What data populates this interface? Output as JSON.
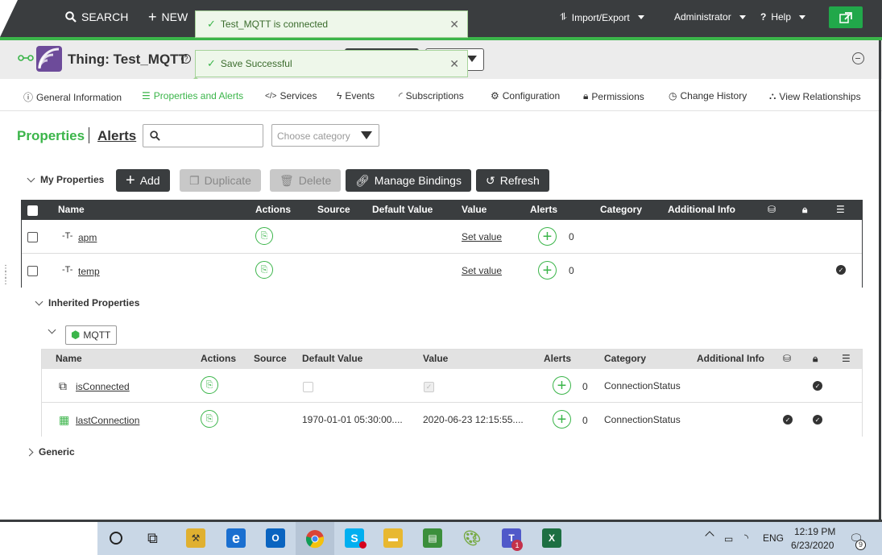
{
  "topbar": {
    "search_label": "SEARCH",
    "new_label": "NEW",
    "import_export_label": "Import/Export",
    "user_label": "Administrator",
    "help_label": "Help"
  },
  "toasts": {
    "connected": "Test_MQTT is connected",
    "saved": "Save Successful"
  },
  "header": {
    "thing_title": "Thing: Test_MQTT"
  },
  "tabs": [
    {
      "label": "General Information"
    },
    {
      "label": "Properties and Alerts"
    },
    {
      "label": "Services"
    },
    {
      "label": "Events"
    },
    {
      "label": "Subscriptions"
    },
    {
      "label": "Configuration"
    },
    {
      "label": "Permissions"
    },
    {
      "label": "Change History"
    },
    {
      "label": "View Relationships"
    }
  ],
  "properties_panel": {
    "properties_link": "Properties",
    "alerts_link": "Alerts",
    "category_placeholder": "Choose category",
    "my_properties_label": "My Properties",
    "inherited_label": "Inherited Properties",
    "mqtt_label": "MQTT",
    "generic_label": "Generic"
  },
  "toolbar": {
    "add": "Add",
    "duplicate": "Duplicate",
    "delete": "Delete",
    "manage_bindings": "Manage Bindings",
    "refresh": "Refresh"
  },
  "my_table": {
    "columns": [
      "Name",
      "Actions",
      "Source",
      "Default Value",
      "Value",
      "Alerts",
      "Category",
      "Additional Info"
    ],
    "rows": [
      {
        "name": "apm",
        "value": "Set value",
        "alerts": "0"
      },
      {
        "name": "temp",
        "value": "Set value",
        "alerts": "0"
      }
    ]
  },
  "inherited_table": {
    "columns": [
      "Name",
      "Actions",
      "Source",
      "Default Value",
      "Value",
      "Alerts",
      "Category",
      "Additional Info"
    ],
    "rows": [
      {
        "name": "isConnected",
        "default": "",
        "value": "",
        "alerts": "0",
        "category": "ConnectionStatus"
      },
      {
        "name": "lastConnection",
        "default": "1970-01-01 05:30:00....",
        "value": "2020-06-23 12:15:55....",
        "alerts": "0",
        "category": "ConnectionStatus"
      }
    ]
  },
  "tray": {
    "lang": "ENG",
    "time": "12:19 PM",
    "date": "6/23/2020",
    "notif_count": "9",
    "teams_badge": "1"
  },
  "colors": {
    "accent": "#3bb54a",
    "dark": "#3a3d3f"
  }
}
